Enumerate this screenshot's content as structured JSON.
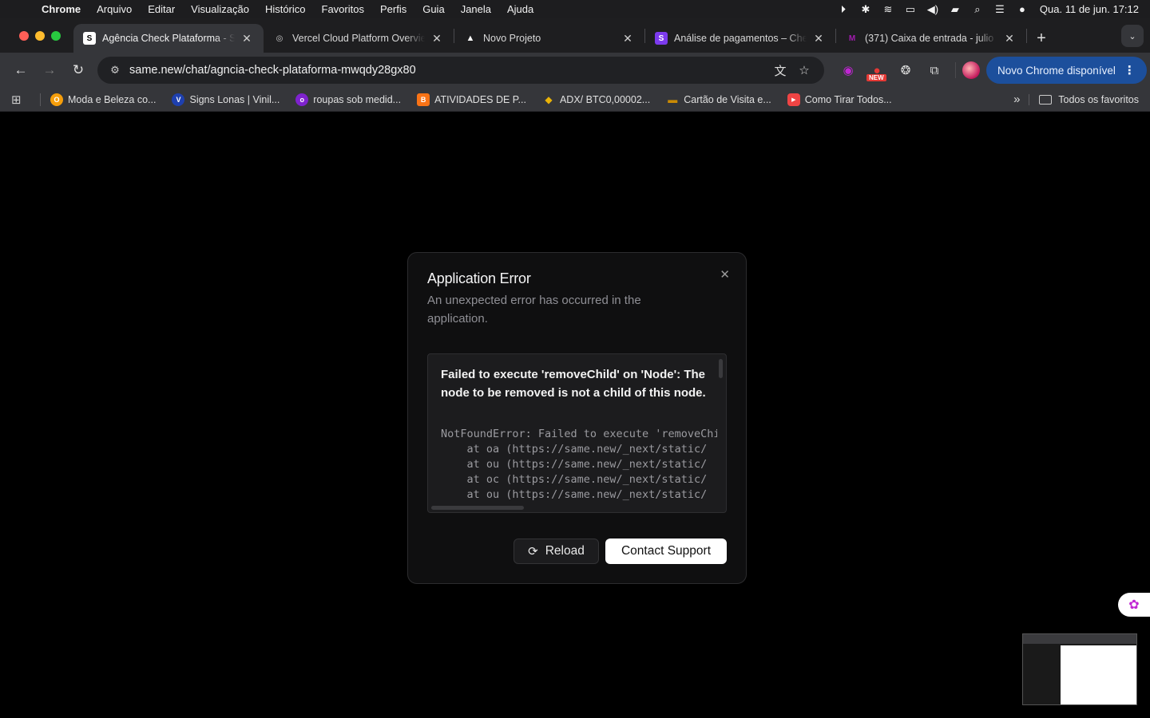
{
  "menubar": {
    "app": "Chrome",
    "items": [
      "Arquivo",
      "Editar",
      "Visualização",
      "Histórico",
      "Favoritos",
      "Perfis",
      "Guia",
      "Janela",
      "Ajuda"
    ],
    "clock": "Qua. 11 de jun.  17:12"
  },
  "tabs": [
    {
      "title": "Agência Check Plataforma - S",
      "favicon": "S",
      "favicon_color": "#ffffff",
      "active": true
    },
    {
      "title": "Vercel Cloud Platform Overvie",
      "favicon": "◎",
      "favicon_color": "#cccccc",
      "active": false
    },
    {
      "title": "Novo Projeto",
      "favicon": "▲",
      "favicon_color": "#ffffff",
      "active": false
    },
    {
      "title": "Análise de pagamentos – Che",
      "favicon": "S",
      "favicon_color": "#7c3aed",
      "active": false
    },
    {
      "title": "(371) Caixa de entrada - julio",
      "favicon": "M",
      "favicon_color": "#7b1fa2",
      "active": false
    }
  ],
  "toolbar": {
    "url": "same.new/chat/agncia-check-plataforma-mwqdy28gx80",
    "update_label": "Novo Chrome disponível",
    "new_badge": "NEW"
  },
  "bookmarks": [
    {
      "label": "Moda e Beleza co...",
      "color": "#f59e0b",
      "glyph": "O"
    },
    {
      "label": "Signs Lonas | Vinil...",
      "color": "#1e40af",
      "glyph": "V"
    },
    {
      "label": "roupas sob medid...",
      "color": "#7e22ce",
      "glyph": "o"
    },
    {
      "label": "ATIVIDADES DE P...",
      "color": "#f97316",
      "glyph": "B"
    },
    {
      "label": "ADX/ BTC0,00002...",
      "color": "#eab308",
      "glyph": "◆"
    },
    {
      "label": "Cartão de Visita e...",
      "color": "#ca8a04",
      "glyph": "▬"
    },
    {
      "label": "Como Tirar Todos...",
      "color": "#ef4444",
      "glyph": "▶"
    }
  ],
  "bookmarks_all": "Todos os favoritos",
  "dialog": {
    "title": "Application Error",
    "description": "An unexpected error has occurred in the application.",
    "error_message": "Failed to execute 'removeChild' on 'Node': The node to be removed is not a child of this node.",
    "stack": "NotFoundError: Failed to execute 'removeChild' on 'Node'\n    at oa (https://same.new/_next/static/\n    at ou (https://same.new/_next/static/\n    at oc (https://same.new/_next/static/\n    at ou (https://same.new/_next/static/",
    "reload_label": "Reload",
    "support_label": "Contact Support"
  }
}
